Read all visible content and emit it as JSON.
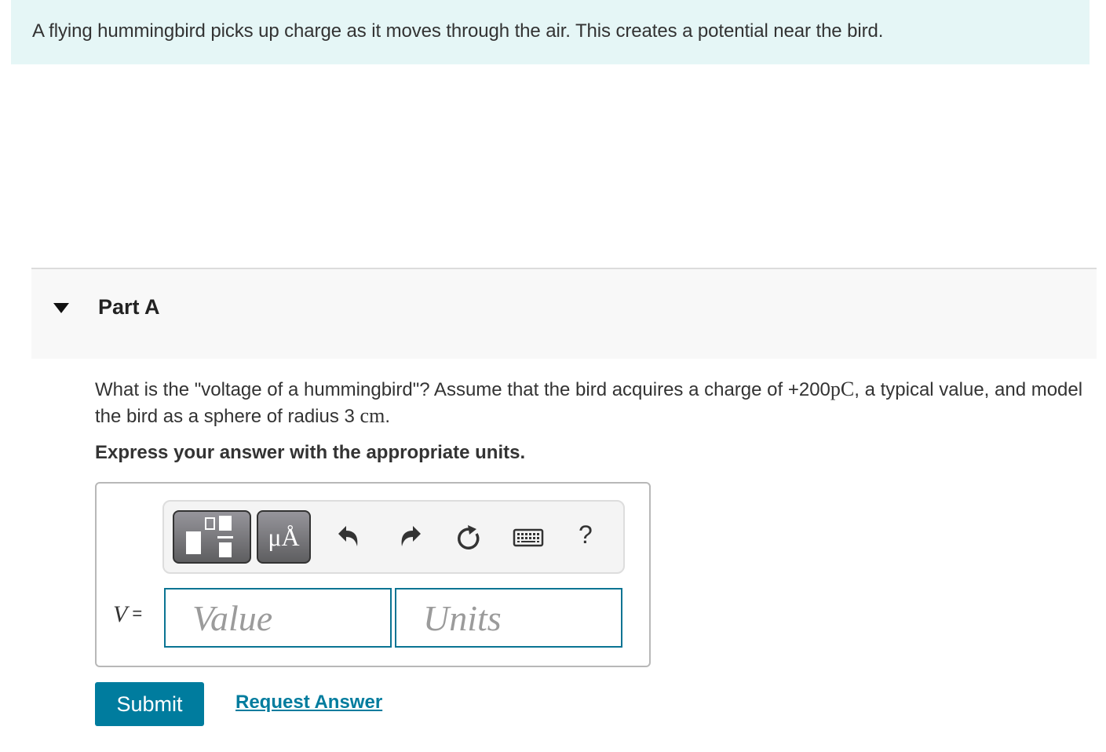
{
  "intro": {
    "text": "A flying hummingbird picks up charge as it moves through the air. This creates a potential near the bird."
  },
  "part": {
    "title": "Part A",
    "expanded": true
  },
  "question": {
    "text_before_charge": "What is the \"voltage of a hummingbird\"? Assume that the bird acquires a charge of +200",
    "charge_unit": "pC",
    "text_after_charge": ", a typical value, and model the bird as a sphere of radius 3 ",
    "radius_unit": "cm",
    "text_end": "."
  },
  "instruction": "Express your answer with the appropriate units.",
  "toolbar": {
    "buttons": [
      {
        "name": "templates",
        "icon": "fraction-template-icon"
      },
      {
        "name": "units",
        "icon": "units-icon",
        "label": "μÅ"
      },
      {
        "name": "undo",
        "icon": "undo-icon"
      },
      {
        "name": "redo",
        "icon": "redo-icon"
      },
      {
        "name": "reset",
        "icon": "reset-icon"
      },
      {
        "name": "keyboard",
        "icon": "keyboard-icon"
      },
      {
        "name": "help",
        "icon": "help-icon",
        "label": "?"
      }
    ]
  },
  "answer": {
    "variable": "V",
    "equals": "=",
    "value": "",
    "value_placeholder": "Value",
    "units": "",
    "units_placeholder": "Units"
  },
  "actions": {
    "submit_label": "Submit",
    "request_answer_label": "Request Answer"
  },
  "colors": {
    "intro_bg": "#e5f6f6",
    "accent": "#007c9e",
    "field_border": "#0a7493",
    "part_bg": "#f8f8f8"
  }
}
